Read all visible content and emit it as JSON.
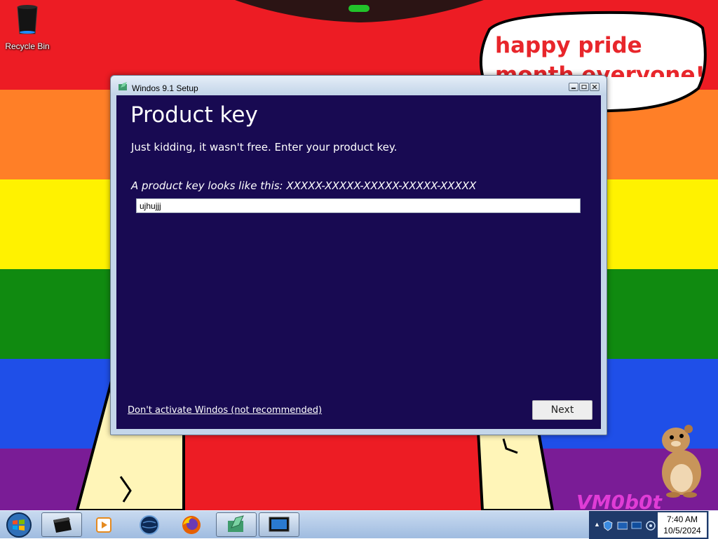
{
  "desktop": {
    "icons": [
      {
        "label": "Recycle Bin",
        "icon": "recycle-bin-icon"
      }
    ],
    "wallpaper_text": "happy pride month everyone!",
    "watermark": "VM0b0t"
  },
  "window": {
    "title": "Windos 9.1 Setup",
    "heading": "Product key",
    "description": "Just kidding, it wasn't free. Enter your product key.",
    "hint": "A product key looks like this: XXXXX-XXXXX-XXXXX-XXXXX-XXXXX",
    "product_key_value": "ujhujjj",
    "skip_link": "Don't activate Windos (not recommended)",
    "next_label": "Next"
  },
  "taskbar": {
    "apps": [
      {
        "name": "command-window-icon",
        "active": true
      },
      {
        "name": "media-player-icon",
        "active": false
      },
      {
        "name": "globe-icon",
        "active": false
      },
      {
        "name": "firefox-icon",
        "active": false
      },
      {
        "name": "setup-icon",
        "active": true
      },
      {
        "name": "monitor-icon",
        "active": true
      }
    ],
    "clock_time": "7:40 AM",
    "clock_date": "10/5/2024"
  },
  "colors": {
    "setup_background": "#180a52",
    "pride_red": "#ed1c24",
    "pride_orange": "#ff7f27",
    "pride_yellow": "#fff200",
    "pride_green": "#108a10",
    "pride_blue": "#1f4fe8",
    "pride_purple": "#7a1c96"
  }
}
